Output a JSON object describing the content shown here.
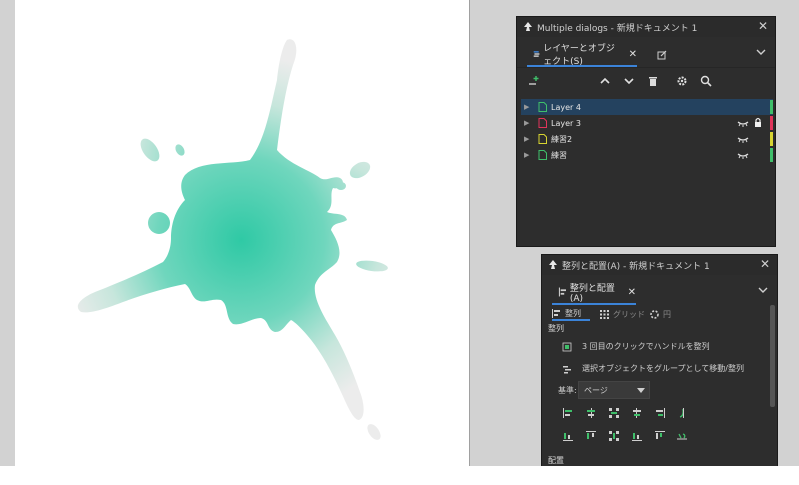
{
  "layers_dialog": {
    "title": "Multiple dialogs - 新規ドキュメント 1",
    "tab_label": "レイヤーとオブジェクト(S)",
    "layers": [
      {
        "name": "Layer 4",
        "selected": true,
        "icon_color": "#3fbf6a",
        "swatch": "#3fbf6a",
        "eye": false,
        "lock": false
      },
      {
        "name": "Layer 3",
        "selected": false,
        "icon_color": "#e0345a",
        "swatch": "#e0345a",
        "eye": true,
        "lock": true
      },
      {
        "name": "練習2",
        "selected": false,
        "icon_color": "#d7d431",
        "swatch": "#d7d431",
        "eye": true,
        "lock": false
      },
      {
        "name": "練習",
        "selected": false,
        "icon_color": "#3fbf6a",
        "swatch": "#3fbf6a",
        "eye": true,
        "lock": false
      }
    ]
  },
  "align_dialog": {
    "title": "整列と配置(A) - 新規ドキュメント 1",
    "tab_label": "整列と配置(A)",
    "subtabs": [
      "整列",
      "グリッド",
      "円"
    ],
    "section_align": "整列",
    "option_third_click": "3 回目のクリックでハンドルを整列",
    "option_move_as_group": "選択オブジェクトをグループとして移動/整列",
    "relative_label": "基準:",
    "relative_value": "ページ",
    "section_distribute": "配置"
  },
  "colors": {
    "accent": "#3b83d8",
    "panel_bg": "#2d2d2d",
    "selection": "#24425f",
    "splat": "#3fcfac",
    "splat_fade": "#e6e6e6"
  }
}
